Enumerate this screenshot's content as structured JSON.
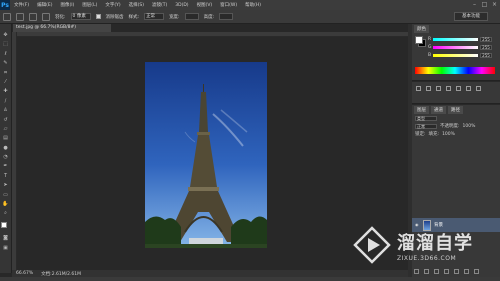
{
  "app": {
    "logo": "Ps"
  },
  "menu": [
    "文件(F)",
    "编辑(E)",
    "图像(I)",
    "图层(L)",
    "文字(Y)",
    "选择(S)",
    "滤镜(T)",
    "3D(D)",
    "视图(V)",
    "窗口(W)",
    "帮助(H)"
  ],
  "options": {
    "feather_label": "羽化:",
    "feather_value": "0 像素",
    "antialias_label": "消除锯齿",
    "style_label": "样式:",
    "style_value": "正常",
    "width_label": "宽度:",
    "height_label": "高度:",
    "workspace": "基本功能"
  },
  "document": {
    "tab_title": "test.jpg @ 66.7%(RGB/8#)",
    "zoom": "66.67%",
    "status_info": "文档:2.61M/2.61M"
  },
  "color_panel": {
    "tab": "颜色",
    "sliders": [
      {
        "label": "R",
        "value": "255"
      },
      {
        "label": "G",
        "value": "255"
      },
      {
        "label": "B",
        "value": "255"
      }
    ]
  },
  "layers_panel": {
    "tabs": [
      "图层",
      "通道",
      "路径"
    ],
    "kind": "类型",
    "blend_mode": "正常",
    "opacity_label": "不透明度:",
    "opacity_value": "100%",
    "lock_label": "锁定:",
    "fill_label": "填充:",
    "fill_value": "100%",
    "layer_name": "背景"
  },
  "watermark": {
    "brand": "溜溜自学",
    "url": "ZIXUE.3D66.COM"
  },
  "colors": {
    "accent": "#31a8ff",
    "selected_layer": "#4a5a72"
  }
}
